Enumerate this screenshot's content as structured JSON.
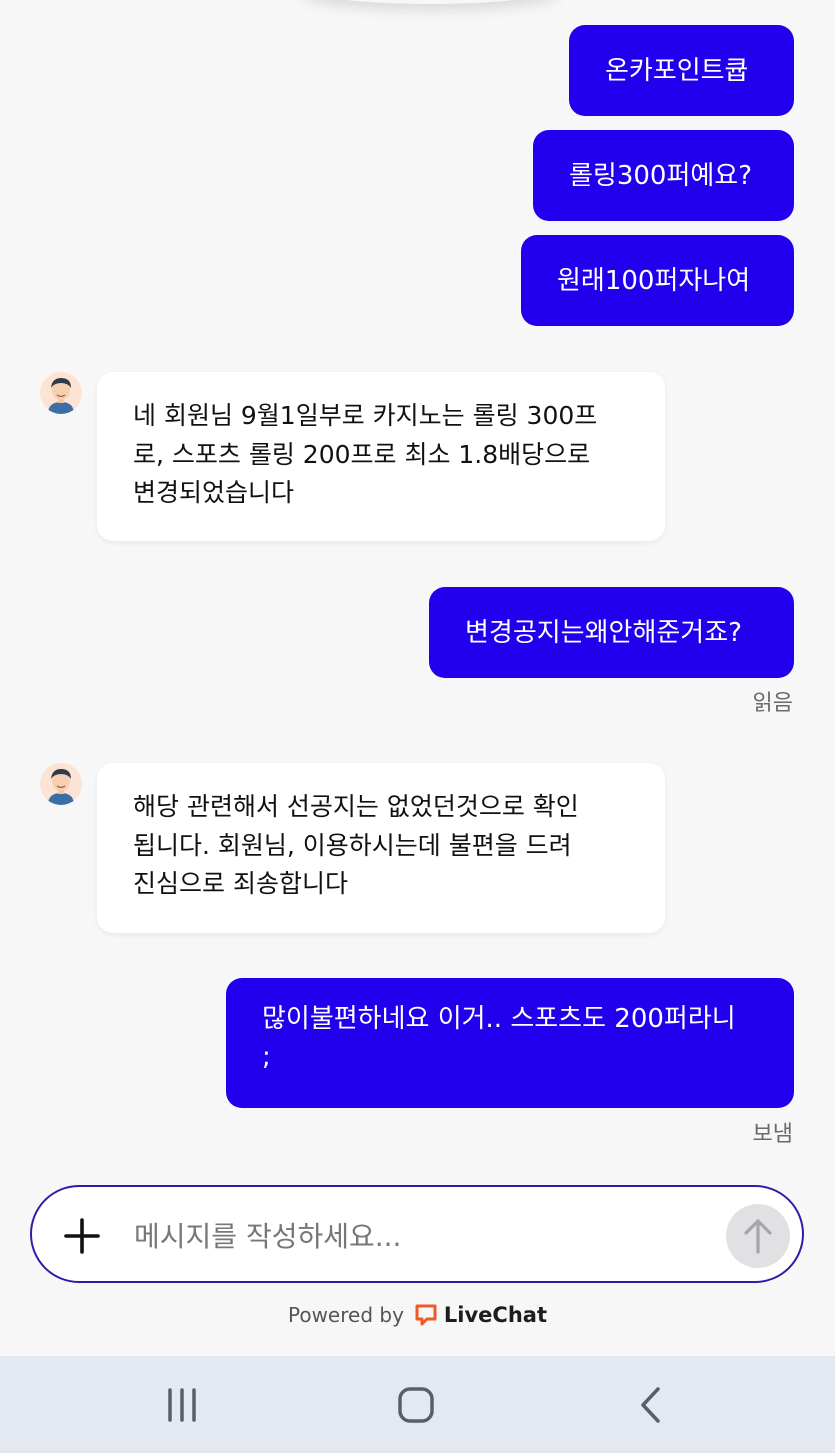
{
  "messages": [
    {
      "text": "온카포인트큡"
    },
    {
      "text": "롤링300퍼예요?"
    },
    {
      "text": "원래100퍼자나여"
    },
    {
      "lines": [
        "네 회원님 9월1일부로 카지노는 롤링 300프",
        "로, 스포츠 롤링 200프로 최소 1.8배당으로",
        "변경되었습니다"
      ]
    },
    {
      "text": "변경공지는왜안해준거죠?",
      "status": "읽음"
    },
    {
      "lines": [
        "해당 관련해서 선공지는 없었던것으로 확인",
        "됩니다. 회원님, 이용하시는데 불편을 드려",
        "진심으로 죄송합니다"
      ]
    },
    {
      "lines": [
        "많이불편하네요 이거.. 스포츠도 200퍼라니",
        ";"
      ],
      "status": "보냄"
    }
  ],
  "composer": {
    "placeholder": "메시지를 작성하세요..."
  },
  "footer": {
    "powered_by": "Powered by",
    "brand": "LiveChat"
  },
  "icons": {
    "add": "plus-icon",
    "send": "arrow-up-icon",
    "brand": "livechat-logo-icon",
    "agent": "agent-avatar"
  },
  "colors": {
    "outgoing_bubble": "#2200ee",
    "incoming_bubble": "#ffffff",
    "composer_border": "#2a1fa8",
    "brand_orange": "#f05a24"
  }
}
